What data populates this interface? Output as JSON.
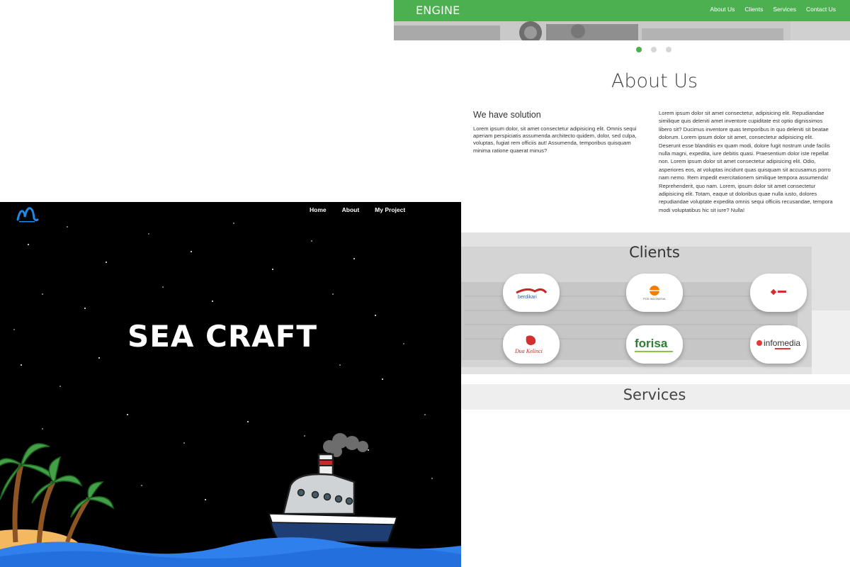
{
  "engine": {
    "brand": "ENGINE",
    "menu": [
      "About Us",
      "Clients",
      "Services",
      "Contact Us"
    ],
    "carousel_active_index": 0,
    "about_title": "About Us",
    "solution_title": "We have solution",
    "solution_text": "Lorem ipsum dolor, sit amet consectetur adipisicing elit. Omnis sequi aperiam perspiciatis assumenda architecto quidem, dolor, sed culpa, voluptas, fugiat rem officiis aut! Assumenda, temporibus quisquam minima ratione quaerat minus?",
    "right_text": "Lorem ipsum dolor sit amet consectetur, adipisicing elit. Repudiandae similique quis deleniti amet inventore cupiditate est optio dignissimos libero sit? Ducimus inventore quas temporibus in quo deleniti sit beatae dolorum. Lorem ipsum dolor sit amet, consectetur adipisicing elit. Deserunt esse blanditiis ex quam modi, dolore fugit nostrum unde facilis nulla magni, expedita, iure debitis quasi. Praesentium dolor iste repellat non. Lorem ipsum dolor sit amet consectetur adipisicing elit. Odio, asperiores eos, at voluptas incidunt quas quisquam sit accusamus porro nam nemo. Rem impedit exercitationem similique tempora assumenda! Reprehenderit, quo nam. Lorem, ipsum dolor sit amet consectetur adipisicing elit. Totam, eaque ut doloribus quae nulla iusto, dolores repudiandae voluptate expedita omnis sequi officiis recusandae, tempora modi voluptatibus hic sit iure? Nulla!",
    "clients_title": "Clients",
    "client_logos": [
      "berdikari",
      "pos-indonesia",
      "indosat",
      "dua-kelinci",
      "forisa",
      "infomedia"
    ],
    "client_logo_texts": [
      "berdikari",
      "POS INDONESIA",
      "",
      "Dua Kelinci",
      "forisa",
      "infomedia"
    ],
    "services_title": "Services",
    "colors": {
      "nav": "#4caf50",
      "dot_active": "#4caf50",
      "dot": "#d6d6d6"
    }
  },
  "seacraft": {
    "nav": [
      "Home",
      "About",
      "My Project"
    ],
    "title": "SEA CRAFT",
    "logo_icon": "wave-logo-icon",
    "colors": {
      "background": "#000000",
      "sea": "#2f80ed",
      "island": "#f4b860",
      "ship_hull": "#1f3e73"
    }
  }
}
